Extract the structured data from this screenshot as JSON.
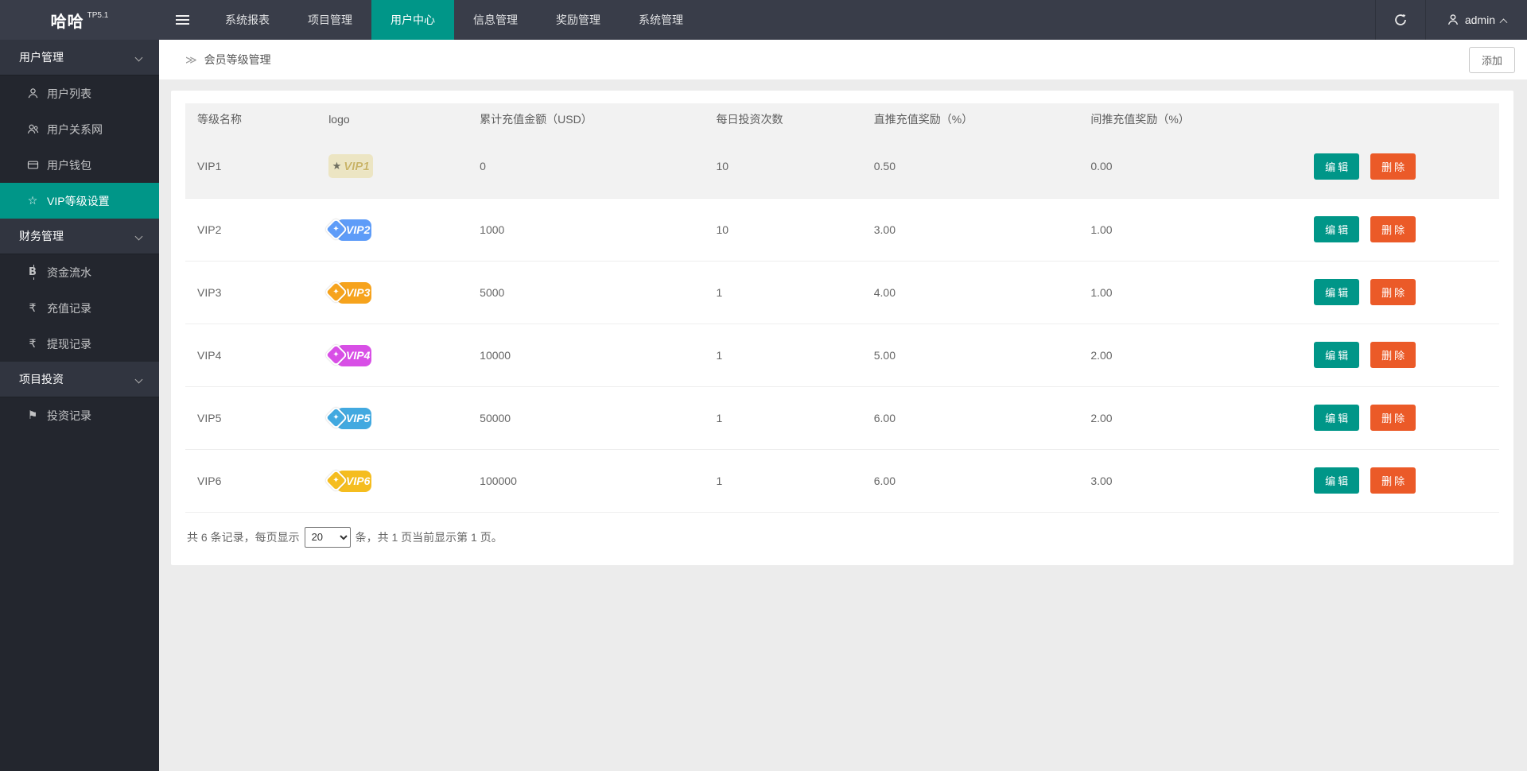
{
  "colors": {
    "accent": "#009688",
    "danger": "#eb5a28",
    "navbar_bg": "#393D49",
    "sidebar_bg": "#23262E"
  },
  "icons": {
    "breadcrumb": "≫",
    "star_outline": "☆",
    "star_filled": "★",
    "rupee": "₹",
    "flag": "⚑",
    "bitcoin_base": "B"
  },
  "navbar": {
    "logo_text": "哈哈",
    "logo_version": "TP5.1",
    "menu": [
      {
        "label": "系统报表"
      },
      {
        "label": "项目管理"
      },
      {
        "label": "用户中心"
      },
      {
        "label": "信息管理"
      },
      {
        "label": "奖励管理"
      },
      {
        "label": "系统管理"
      }
    ],
    "username": "admin"
  },
  "sidebar": {
    "sections": [
      {
        "title": "用户管理",
        "items": [
          {
            "label": "用户列表"
          },
          {
            "label": "用户关系网"
          },
          {
            "label": "用户钱包"
          },
          {
            "label": "VIP等级设置"
          }
        ]
      },
      {
        "title": "财务管理",
        "items": [
          {
            "label": "资金流水"
          },
          {
            "label": "充值记录"
          },
          {
            "label": "提现记录"
          }
        ]
      },
      {
        "title": "项目投资",
        "items": [
          {
            "label": "投资记录"
          }
        ]
      }
    ]
  },
  "breadcrumb": {
    "title": "会员等级管理"
  },
  "toolbar": {
    "add_label": "添加"
  },
  "table": {
    "headers": [
      "等级名称",
      "logo",
      "累计充值金额（USD）",
      "每日投资次数",
      "直推充值奖励（%）",
      "间推充值奖励（%）",
      ""
    ],
    "actions": {
      "edit": "编辑",
      "delete": "删除"
    },
    "rows": [
      {
        "level": "VIP1",
        "logo_text": "VIP1",
        "logo_bg": "#ece5c3",
        "logo_color": "#c9b467",
        "amount": "0",
        "daily": "10",
        "direct": "0.50",
        "indirect": "0.00"
      },
      {
        "level": "VIP2",
        "logo_text": "VIP2",
        "logo_color": "#5e9cf8",
        "amount": "1000",
        "daily": "10",
        "direct": "3.00",
        "indirect": "1.00"
      },
      {
        "level": "VIP3",
        "logo_text": "VIP3",
        "logo_color": "#f6a31d",
        "amount": "5000",
        "daily": "1",
        "direct": "4.00",
        "indirect": "1.00"
      },
      {
        "level": "VIP4",
        "logo_text": "VIP4",
        "logo_color": "#d84fe6",
        "amount": "10000",
        "daily": "1",
        "direct": "5.00",
        "indirect": "2.00"
      },
      {
        "level": "VIP5",
        "logo_text": "VIP5",
        "logo_color": "#42a9e0",
        "amount": "50000",
        "daily": "1",
        "direct": "6.00",
        "indirect": "2.00"
      },
      {
        "level": "VIP6",
        "logo_text": "VIP6",
        "logo_color": "#f5bd1f",
        "amount": "100000",
        "daily": "1",
        "direct": "6.00",
        "indirect": "3.00"
      }
    ]
  },
  "pagination": {
    "prefix": "共 6 条记录，每页显示",
    "page_size": "20",
    "suffix": "条，共 1 页当前显示第 1 页。"
  }
}
